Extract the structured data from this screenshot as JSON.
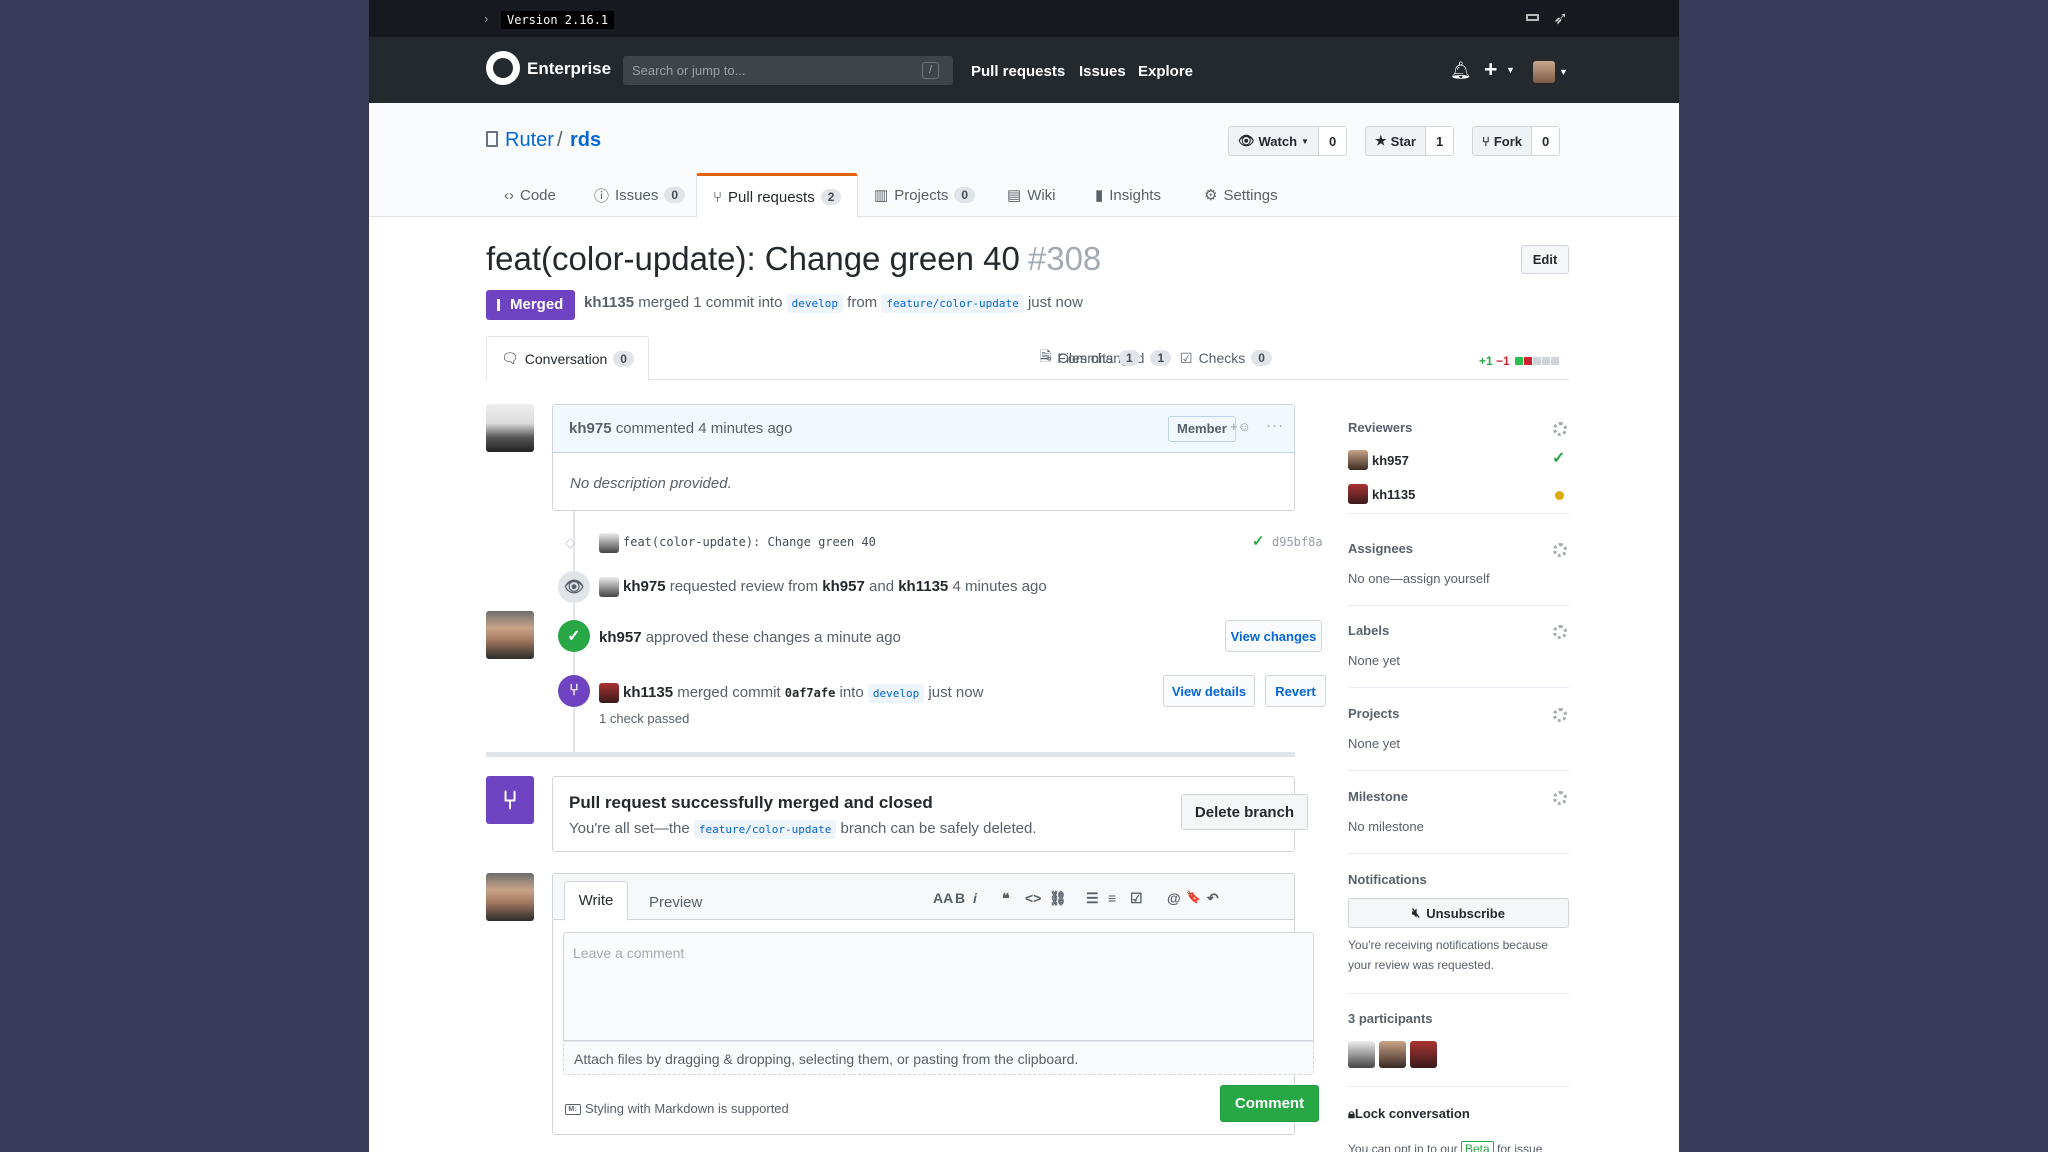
{
  "version": "Version 2.16.1",
  "header": {
    "brand": "Enterprise",
    "search_placeholder": "Search or jump to...",
    "search_key": "/",
    "nav": [
      "Pull requests",
      "Issues",
      "Explore"
    ]
  },
  "repo": {
    "owner": "Ruter",
    "separator": "/",
    "name": "rds",
    "watch_label": "Watch",
    "watch_count": "0",
    "star_label": "Star",
    "star_count": "1",
    "fork_label": "Fork",
    "fork_count": "0",
    "tabs": [
      {
        "label": "Code",
        "count": null
      },
      {
        "label": "Issues",
        "count": "0"
      },
      {
        "label": "Pull requests",
        "count": "2"
      },
      {
        "label": "Projects",
        "count": "0"
      },
      {
        "label": "Wiki",
        "count": null
      },
      {
        "label": "Insights",
        "count": null
      },
      {
        "label": "Settings",
        "count": null
      }
    ]
  },
  "pr": {
    "title": "feat(color-update): Change green 40",
    "number": "#308",
    "edit_label": "Edit",
    "state": "Merged",
    "meta": {
      "author": "kh1135",
      "text1": "merged 1 commit into",
      "base": "develop",
      "text2": "from",
      "head": "feature/color-update",
      "time": "just now"
    },
    "tabs": [
      {
        "label": "Conversation",
        "count": "0"
      },
      {
        "label": "Commits",
        "count": "1"
      },
      {
        "label": "Checks",
        "count": "0"
      },
      {
        "label": "Files changed",
        "count": "1"
      }
    ],
    "diff_add": "+1",
    "diff_del": "−1"
  },
  "colors": {
    "merged_purple": "#6f42c1",
    "success_green": "#28a745",
    "pending_yellow": "#dbab09",
    "danger_red": "#cb2431",
    "link_blue": "#0366d6",
    "tab_orange": "#e36209"
  },
  "comment": {
    "author": "kh975",
    "action": "commented 4 minutes ago",
    "badge": "Member",
    "reaction": "+☺",
    "more": "···",
    "body": "No description provided."
  },
  "timeline": {
    "commit_message": "feat(color-update): Change green 40",
    "commit_sha": "d95bf8a",
    "review_request": {
      "author": "kh975",
      "text1": "requested review from",
      "r1": "kh957",
      "and": "and",
      "r2": "kh1135",
      "time": "4 minutes ago"
    },
    "approval": {
      "author": "kh957",
      "text": "approved these changes a minute ago",
      "button": "View changes"
    },
    "merge": {
      "author": "kh1135",
      "text1": "merged commit",
      "sha": "0af7afe",
      "text2": "into",
      "branch": "develop",
      "time": "just now",
      "checks": "1 check passed",
      "details_btn": "View details",
      "revert_btn": "Revert"
    }
  },
  "merged_box": {
    "title": "Pull request successfully merged and closed",
    "text1": "You're all set—the",
    "branch": "feature/color-update",
    "text2": "branch can be safely deleted.",
    "delete_btn": "Delete branch"
  },
  "new_comment": {
    "write_tab": "Write",
    "preview_tab": "Preview",
    "toolbar": [
      "AA",
      "B",
      "i",
      "❝",
      "<>",
      "⛓",
      "☰",
      "≡",
      "☑",
      "@",
      "🔖",
      "↶"
    ],
    "placeholder": "Leave a comment",
    "attach": "Attach files by dragging & dropping, selecting them, or pasting from the clipboard.",
    "markdown_badge": "M↓",
    "markdown_note": "Styling with Markdown is supported",
    "submit": "Comment"
  },
  "sidebar": {
    "reviewers_label": "Reviewers",
    "reviewers": [
      {
        "name": "kh957",
        "status": "approved"
      },
      {
        "name": "kh1135",
        "status": "pending"
      }
    ],
    "assignees_label": "Assignees",
    "assignees_value": "No one—assign yourself",
    "labels_label": "Labels",
    "labels_value": "None yet",
    "projects_label": "Projects",
    "projects_value": "None yet",
    "milestone_label": "Milestone",
    "milestone_value": "No milestone",
    "notifications_label": "Notifications",
    "unsubscribe": "Unsubscribe",
    "notif_reason_1": "You're receiving notifications because",
    "notif_reason_2": "your review was requested.",
    "participants_label": "3 participants",
    "lock_label": "Lock conversation",
    "footer_text1": "You can opt in to our",
    "footer_beta": "Beta",
    "footer_text2": "for issue"
  }
}
